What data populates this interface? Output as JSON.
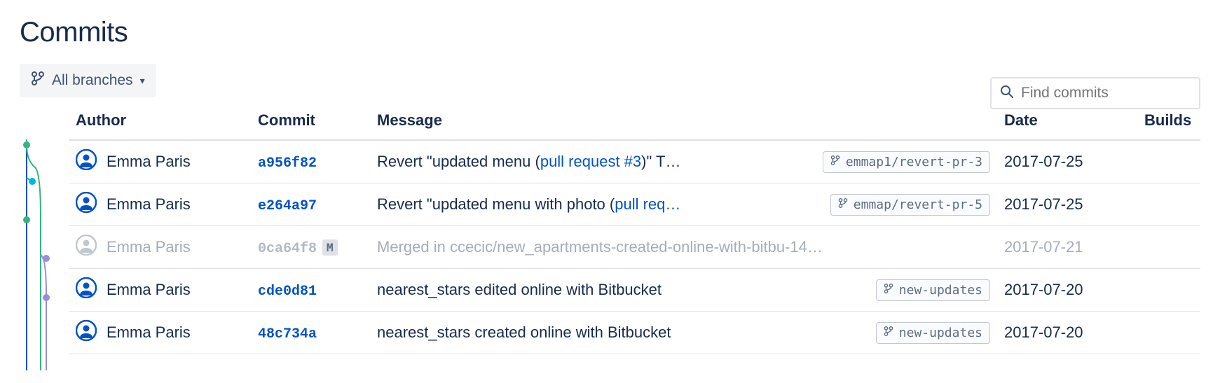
{
  "title": "Commits",
  "branch_selector": {
    "label": "All branches"
  },
  "search": {
    "placeholder": "Find commits"
  },
  "columns": {
    "author": "Author",
    "commit": "Commit",
    "message": "Message",
    "date": "Date",
    "builds": "Builds"
  },
  "commits": [
    {
      "author": "Emma Paris",
      "hash": "a956f82",
      "merge": false,
      "muted": false,
      "msg_prefix": "Revert \"updated menu (",
      "msg_link": "pull request #3",
      "msg_suffix": ")\" T…",
      "branch": "emmap1/revert-pr-3",
      "date": "2017-07-25"
    },
    {
      "author": "Emma Paris",
      "hash": "e264a97",
      "merge": false,
      "muted": false,
      "msg_prefix": "Revert \"updated menu with photo (",
      "msg_link": "pull req…",
      "msg_suffix": "",
      "branch": "emmap/revert-pr-5",
      "date": "2017-07-25"
    },
    {
      "author": "Emma Paris",
      "hash": "0ca64f8",
      "merge": true,
      "muted": true,
      "msg_prefix": "Merged in ccecic/new_apartments-created-online-with-bitbu-14…",
      "msg_link": "",
      "msg_suffix": "",
      "branch": "",
      "date": "2017-07-21"
    },
    {
      "author": "Emma Paris",
      "hash": "cde0d81",
      "merge": false,
      "muted": false,
      "msg_prefix": "nearest_stars edited online with Bitbucket",
      "msg_link": "",
      "msg_suffix": "",
      "branch": "new-updates",
      "date": "2017-07-20"
    },
    {
      "author": "Emma Paris",
      "hash": "48c734a",
      "merge": false,
      "muted": false,
      "msg_prefix": "nearest_stars created online with Bitbucket",
      "msg_link": "",
      "msg_suffix": "",
      "branch": "new-updates",
      "date": "2017-07-20"
    }
  ],
  "merge_badge_label": "M"
}
